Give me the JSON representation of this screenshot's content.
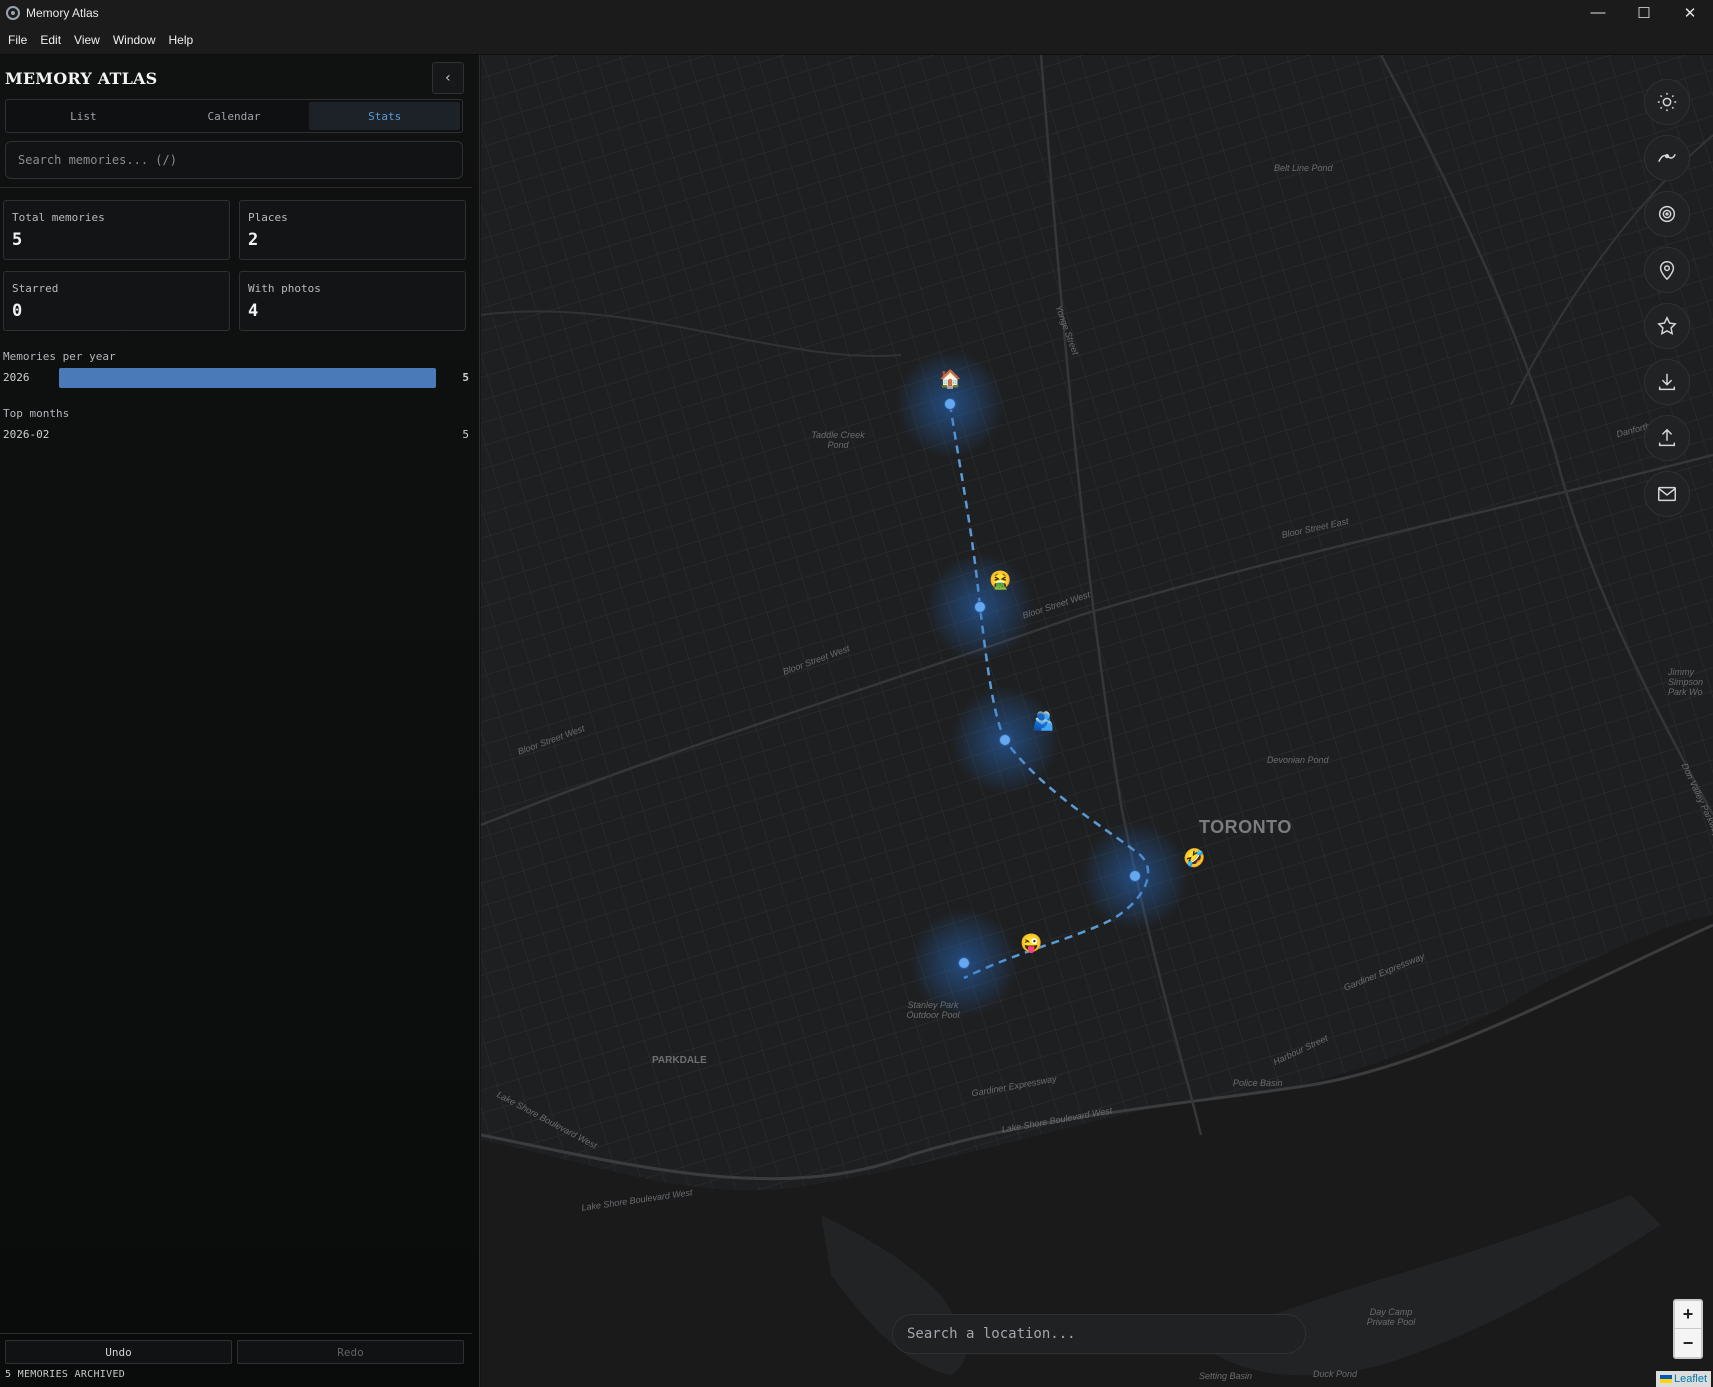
{
  "window": {
    "title": "Memory Atlas"
  },
  "menu": [
    "File",
    "Edit",
    "View",
    "Window",
    "Help"
  ],
  "sidebar": {
    "title": "MEMORY ATLAS",
    "collapse_icon": "chevron-left-icon",
    "tabs": [
      {
        "label": "List",
        "active": false
      },
      {
        "label": "Calendar",
        "active": false
      },
      {
        "label": "Stats",
        "active": true
      }
    ],
    "search_placeholder": "Search memories... (/)",
    "stats": [
      {
        "label": "Total memories",
        "value": "5"
      },
      {
        "label": "Places",
        "value": "2"
      },
      {
        "label": "Starred",
        "value": "0"
      },
      {
        "label": "With photos",
        "value": "4"
      }
    ],
    "per_year_label": "Memories per year",
    "per_year": [
      {
        "year": "2026",
        "count": "5",
        "fraction": 1.0
      }
    ],
    "top_months_label": "Top months",
    "top_months": [
      {
        "month": "2026-02",
        "count": "5"
      }
    ],
    "undo_label": "Undo",
    "redo_label": "Redo",
    "status": "5 MEMORIES ARCHIVED"
  },
  "map": {
    "location_search_placeholder": "Search a location...",
    "zoom_in": "+",
    "zoom_out": "−",
    "attribution": "Leaflet",
    "city_label": "TORONTO",
    "district_labels": [
      "PARKDALE"
    ],
    "place_labels": [
      "Belt Line Pond",
      "Taddle Creek Pond",
      "Bloor Street West",
      "Bloor Street West",
      "Bloor Street West",
      "Bloor Street East",
      "Devonian Pond",
      "Stanley Park Outdoor Pool",
      "Gardiner Expressway",
      "Gardiner Expressway",
      "Lake Shore Boulevard West",
      "Lake Shore Boulevard West",
      "Harbour Street",
      "Yonge Street",
      "Danforth",
      "Don Valley Parkway",
      "Police Basin",
      "Setting Basin",
      "Duck Pond",
      "Jimmy Simpson Park Wo",
      "Day Camp Private Pool",
      "Lake Shore Boulevard West"
    ],
    "controls": [
      "sun-icon",
      "route-icon",
      "target-icon",
      "map-pin-icon",
      "star-icon",
      "download-icon",
      "upload-icon",
      "mail-icon"
    ],
    "markers": [
      {
        "emoji": "🏠"
      },
      {
        "emoji": "🤮"
      },
      {
        "emoji": "🫂"
      },
      {
        "emoji": "🤣"
      },
      {
        "emoji": "😜"
      }
    ],
    "route_color": "#5b9bd5"
  }
}
